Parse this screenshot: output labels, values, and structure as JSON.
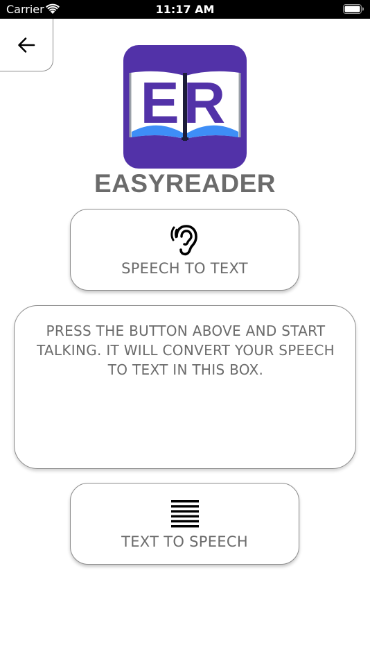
{
  "status_bar": {
    "carrier": "Carrier",
    "time": "11:17 AM",
    "wifi_icon": "wifi-icon",
    "battery_icon": "battery-icon"
  },
  "header": {
    "back_icon": "arrow-left-icon",
    "app_title": "EASYREADER"
  },
  "logo": {
    "letters": "ER",
    "background_color": "#5232A8",
    "page_color": "#ffffff",
    "accent_color": "#3E8EF7"
  },
  "speech_to_text": {
    "icon": "ear-icon",
    "label": "SPEECH TO TEXT"
  },
  "speech_box": {
    "text": "PRESS THE BUTTON ABOVE AND START TALKING. IT WILL CONVERT YOUR SPEECH TO TEXT IN THIS BOX."
  },
  "text_to_speech": {
    "icon": "text-lines-icon",
    "label": "TEXT TO SPEECH"
  },
  "colors": {
    "text_gray": "#6b6b6b",
    "border_gray": "#8c8c8c"
  }
}
